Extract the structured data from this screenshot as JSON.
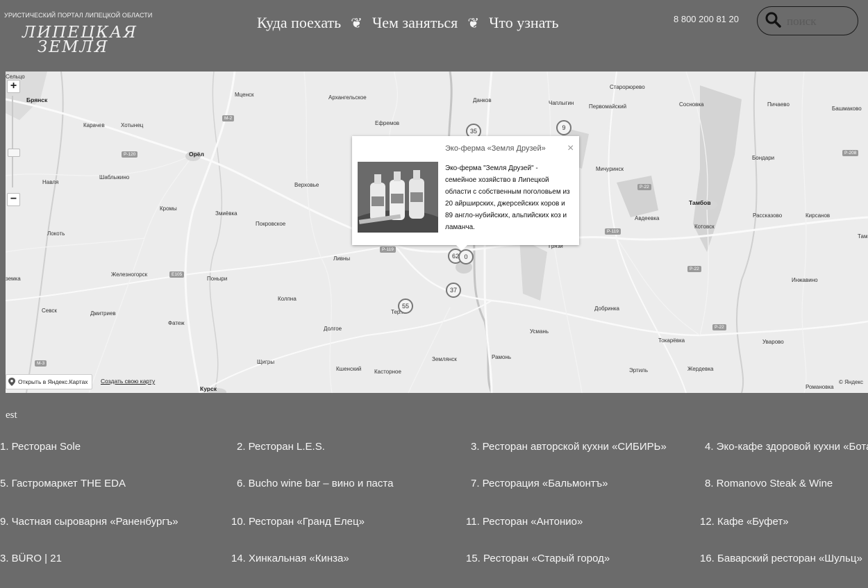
{
  "header": {
    "portal_caption": "УРИСТИЧЕСКИЙ ПОРТАЛ ЛИПЕЦКОЙ ОБЛАСТИ",
    "logo_line1": "ЛИПЕЦКАЯ",
    "logo_line2": "ЗЕМЛЯ",
    "nav": [
      "Куда поехать",
      "Чем заняться",
      "Что узнать"
    ],
    "nav_separator": "❦",
    "phone": "8 800 200 81 20",
    "search_placeholder": "поиск"
  },
  "map": {
    "cities": [
      {
        "name": "Брянск",
        "bold": true
      },
      {
        "name": "Орёл",
        "bold": true
      },
      {
        "name": "Тамбов",
        "bold": true
      },
      {
        "name": "Мценск"
      },
      {
        "name": "Архангельское"
      },
      {
        "name": "Данков"
      },
      {
        "name": "Чаплыгин"
      },
      {
        "name": "Старорюрево"
      },
      {
        "name": "Первомайский"
      },
      {
        "name": "Сосновка"
      },
      {
        "name": "Пичаево"
      },
      {
        "name": "Башмаково"
      },
      {
        "name": "Карачев"
      },
      {
        "name": "Хотынец"
      },
      {
        "name": "Ефремов"
      },
      {
        "name": "Бондари"
      },
      {
        "name": "Навля"
      },
      {
        "name": "Шаблыкино"
      },
      {
        "name": "Мичуринск"
      },
      {
        "name": "Верховье"
      },
      {
        "name": "Кромы"
      },
      {
        "name": "Змиёвка"
      },
      {
        "name": "Покровское"
      },
      {
        "name": "Авдеевка"
      },
      {
        "name": "Рассказово"
      },
      {
        "name": "Кирсанов"
      },
      {
        "name": "Котовск"
      },
      {
        "name": "Локоть"
      },
      {
        "name": "Ливны"
      },
      {
        "name": "Железногорск"
      },
      {
        "name": "Поныри"
      },
      {
        "name": "Инжавино"
      },
      {
        "name": "Колпна"
      },
      {
        "name": "Добринка"
      },
      {
        "name": "Севск"
      },
      {
        "name": "Дмитриев"
      },
      {
        "name": "Фатеж"
      },
      {
        "name": "Долгое"
      },
      {
        "name": "Усмань"
      },
      {
        "name": "Токарёвка"
      },
      {
        "name": "Уварово"
      },
      {
        "name": "Щигры"
      },
      {
        "name": "Кшенский"
      },
      {
        "name": "Касторное"
      },
      {
        "name": "Землянск"
      },
      {
        "name": "Рамонь"
      },
      {
        "name": "Эртиль"
      },
      {
        "name": "Жердевка"
      },
      {
        "name": "Курск",
        "bold": true
      },
      {
        "name": "Романовка"
      },
      {
        "name": "Сельцо"
      },
      {
        "name": "Грязи"
      },
      {
        "name": "земка"
      },
      {
        "name": "Тер..."
      },
      {
        "name": "Там"
      }
    ],
    "roads": [
      "M-2",
      "P-120",
      "P-22",
      "P-119",
      "P-208",
      "E105",
      "P-22",
      "M-3",
      "P-22",
      "P-119"
    ],
    "pins": [
      "35",
      "9",
      "62",
      "0",
      "37",
      "55"
    ],
    "zoom_in": "+",
    "zoom_out": "−",
    "popup": {
      "title": "Эко-ферма «Земля Друзей»",
      "description": "Эко-ферма \"Земля Друзей\" - семейное хозяйство в Липецкой области с собственным поголовьем из 20 айрширских, джерсейских коров и 89 англо-нубийских, альпийских коз и ламанча.",
      "close": "×"
    },
    "open_in_yandex": "Открыть в Яндекс.Картах",
    "create_map": "Создать свою карту",
    "copyright": "© Яндекс"
  },
  "list": {
    "title": "est",
    "items": [
      "1. Ресторан Sole",
      "2. Ресторан L.E.S.",
      "3. Ресторан авторской кухни «СИБИРЬ»",
      "4. Эко-кафе здоровой кухни «Бота",
      "5. Гастромаркет THE EDA",
      "6. Bucho wine bar – вино и паста",
      "7. Ресторация «Бальмонтъ»",
      "8. Romanovo Steak & Wine",
      "9. Частная сыроварня «Раненбургъ»",
      "10. Ресторан «Гранд Елец»",
      "11. Ресторан «Антонио»",
      "12. Кафе «Буфет»",
      "3. BÜRO | 21",
      "14. Хинкальная «Кинза»",
      "15. Ресторан «Старый город»",
      "16. Баварский ресторан «Шульц»"
    ]
  }
}
